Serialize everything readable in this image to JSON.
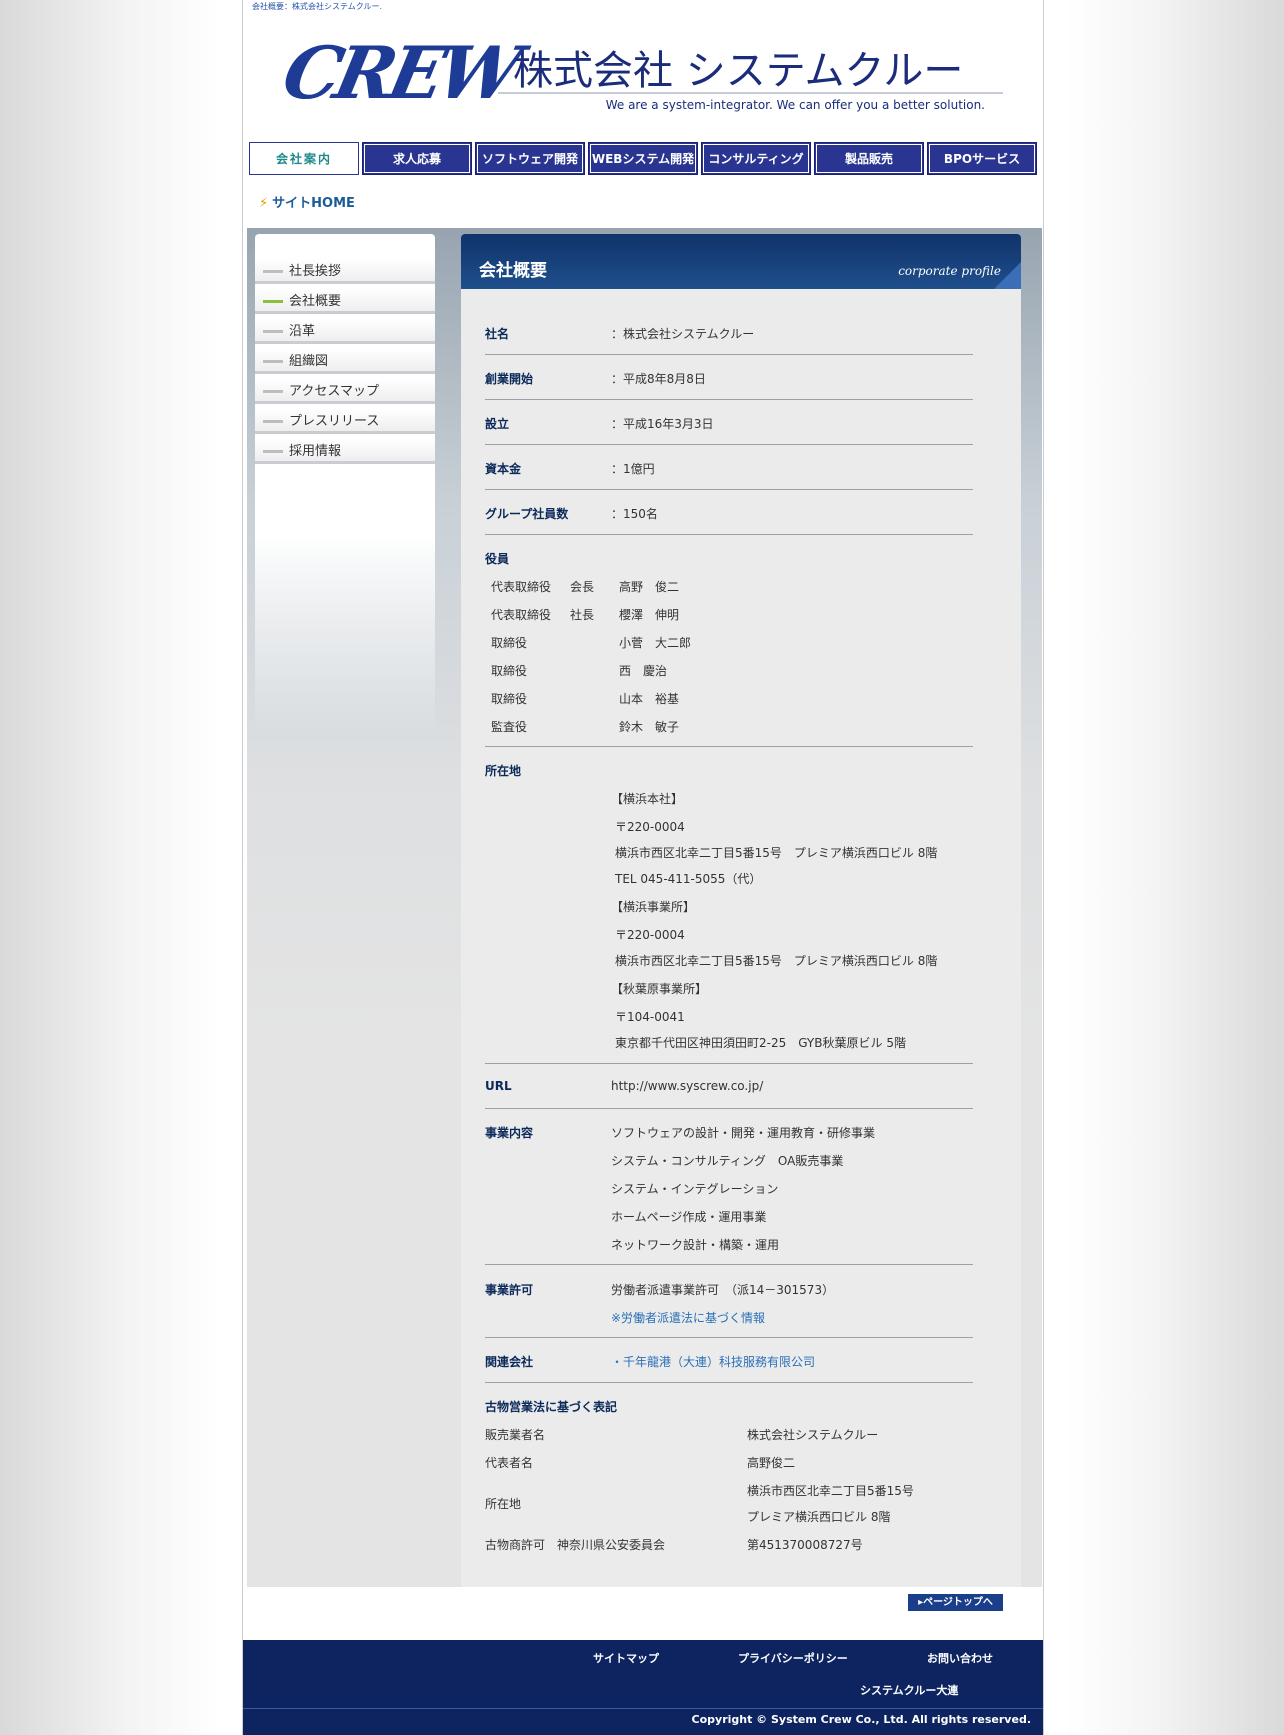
{
  "top_caption": "会社概要：株式会社システムクルー.",
  "header": {
    "logo_text": "CREW",
    "company_name": "株式会社 システムクルー",
    "tagline": "We are a system-integrator.  We can offer you a better solution."
  },
  "nav": {
    "items": [
      {
        "label": "会社案内"
      },
      {
        "label": "求人応募"
      },
      {
        "label": "ソフトウェア開発"
      },
      {
        "label": "WEBシステム開発"
      },
      {
        "label": "コンサルティング"
      },
      {
        "label": "製品販売"
      },
      {
        "label": "BPOサービス"
      }
    ]
  },
  "breadcrumb": {
    "label": "サイトHOME"
  },
  "sidebar": {
    "items": [
      {
        "label": "社長挨拶"
      },
      {
        "label": "会社概要"
      },
      {
        "label": "沿革"
      },
      {
        "label": "組織図"
      },
      {
        "label": "アクセスマップ"
      },
      {
        "label": "プレスリリース"
      },
      {
        "label": "採用情報"
      }
    ]
  },
  "panel": {
    "title": "会社概要",
    "subtitle": "corporate profile"
  },
  "profile": {
    "name": {
      "label": "社名",
      "value": "：株式会社システムクルー"
    },
    "founded": {
      "label": "創業開始",
      "value": "：平成8年8月8日"
    },
    "established": {
      "label": "設立",
      "value": "：平成16年3月3日"
    },
    "capital": {
      "label": "資本金",
      "value": "：1億円"
    },
    "employees": {
      "label": "グループ社員数",
      "value": "：150名"
    },
    "officers": {
      "label": "役員",
      "rows": [
        {
          "role": "代表取締役",
          "title": "会長",
          "name": "高野　俊二"
        },
        {
          "role": "代表取締役",
          "title": "社長",
          "name": "櫻澤　伸明"
        },
        {
          "role": "取締役",
          "title": "",
          "name": "小菅　大二郎"
        },
        {
          "role": "取締役",
          "title": "",
          "name": "西　慶治"
        },
        {
          "role": "取締役",
          "title": "",
          "name": "山本　裕基"
        },
        {
          "role": "監査役",
          "title": "",
          "name": "鈴木　敏子"
        }
      ]
    },
    "address": {
      "label": "所在地",
      "lines": [
        "【横浜本社】",
        "〒220-0004",
        "横浜市西区北幸二丁目5番15号　プレミア横浜西口ビル 8階",
        "TEL 045-411-5055（代）",
        "【横浜事業所】",
        "〒220-0004",
        "横浜市西区北幸二丁目5番15号　プレミア横浜西口ビル 8階",
        "【秋葉原事業所】",
        "〒104-0041",
        "東京都千代田区神田須田町2-25　GYB秋葉原ビル 5階"
      ]
    },
    "url": {
      "label": "URL",
      "value": "http://www.syscrew.co.jp/"
    },
    "business": {
      "label": "事業内容",
      "lines": [
        "ソフトウェアの設計・開発・運用教育・研修事業",
        "システム・コンサルティング　OA販売事業",
        "システム・インテグレーション",
        "ホームページ作成・運用事業",
        "ネットワーク設計・構築・運用"
      ]
    },
    "license": {
      "label": "事業許可",
      "value": "労働者派遣事業許可　（派14－301573）",
      "link": "※労働者派遣法に基づく情報"
    },
    "affiliates": {
      "label": "関連会社",
      "value": "・千年龍港（大連）科技服務有限公司"
    },
    "kobutsu": {
      "label": "古物営業法に基づく表記",
      "rows": [
        {
          "k": "販売業者名",
          "v": [
            "株式会社システムクルー"
          ]
        },
        {
          "k": "代表者名",
          "v": [
            "高野俊二"
          ]
        },
        {
          "k": "所在地",
          "v": [
            "横浜市西区北幸二丁目5番15号",
            "プレミア横浜西口ビル 8階"
          ]
        },
        {
          "k": "古物商許可　神奈川県公安委員会",
          "v": [
            "第451370008727号"
          ]
        }
      ]
    }
  },
  "page_top": "▸ページトップへ",
  "footer": {
    "links": [
      "サイトマップ",
      "プライバシーポリシー",
      "お問い合わせ",
      "システムクルー大連"
    ],
    "copyright": "Copyright © System Crew Co., Ltd. All rights reserved."
  }
}
